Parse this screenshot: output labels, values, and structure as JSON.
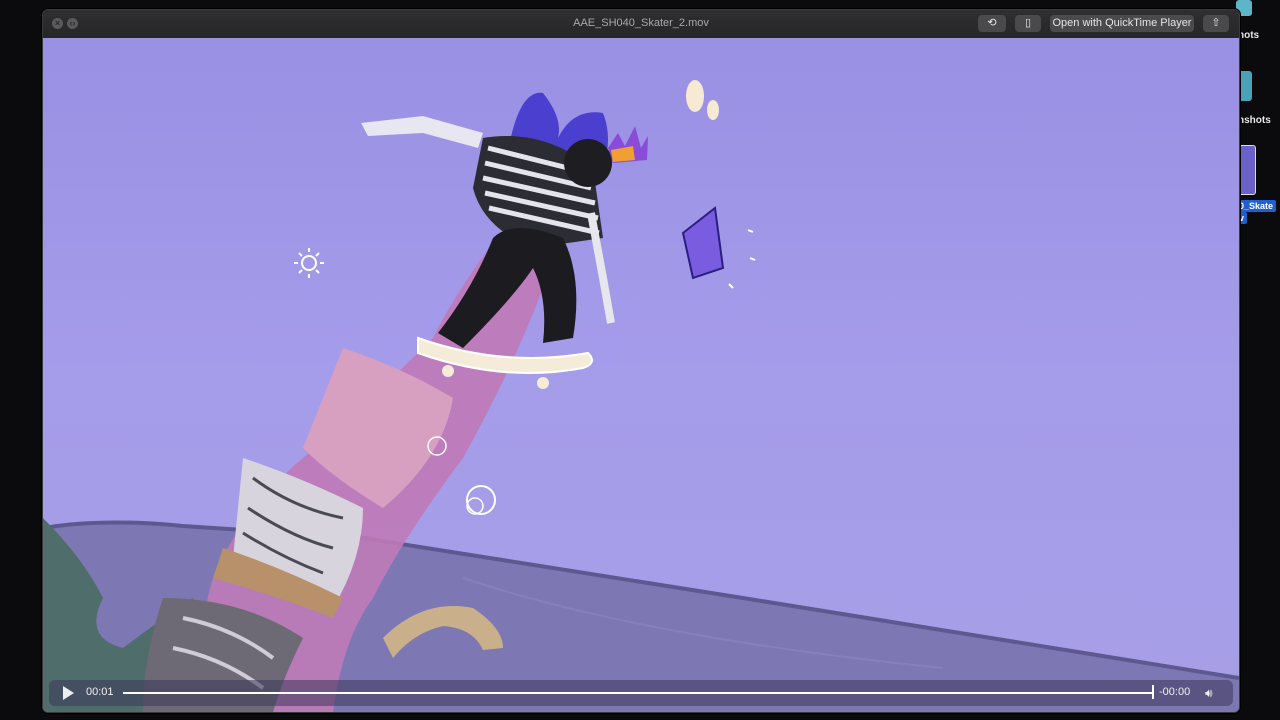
{
  "window": {
    "title": "AAE_SH040_Skater_2.mov",
    "open_with_label": "Open with QuickTime Player",
    "close_icon": "close-icon",
    "fullscreen_icon": "fullscreen-icon",
    "rotate_icon": "rotate-icon",
    "trim_icon": "trim-icon",
    "share_icon": "share-icon"
  },
  "player": {
    "elapsed": "00:01",
    "remaining": "-00:00",
    "progress": 1.0,
    "play_icon": "play-icon",
    "volume_icon": "volume-icon"
  },
  "desktop": {
    "icons": [
      {
        "label": "hots"
      },
      {
        "label": "nshots"
      },
      {
        "label": "0_Skate",
        "sub": "v"
      }
    ]
  },
  "colors": {
    "sky": "#a39ae8",
    "accent_selection": "#1f5fd0"
  }
}
